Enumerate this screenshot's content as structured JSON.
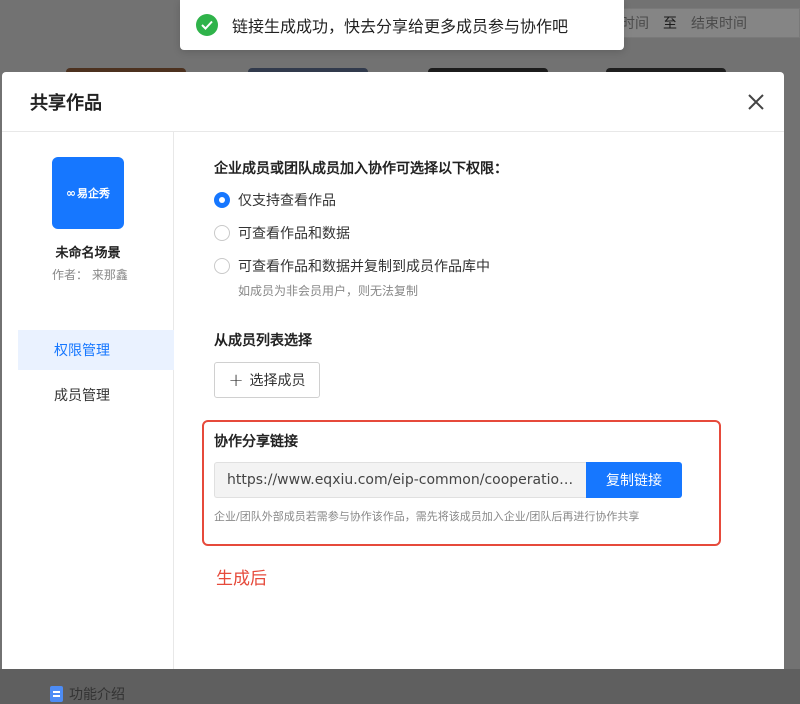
{
  "background": {
    "date_start_placeholder": "时间",
    "date_separator": "至",
    "date_end_placeholder": "结束时间"
  },
  "toast": {
    "message": "链接生成成功，快去分享给更多成员参与协作吧",
    "icon": "check-circle-icon",
    "color": "#2fb34a"
  },
  "modal": {
    "title": "共享作品",
    "close_icon": "close-icon"
  },
  "work": {
    "cover_logo": "易企秀",
    "name": "未命名场景",
    "author": "作者：  来那鑫"
  },
  "sidebar": {
    "items": [
      {
        "label": "权限管理",
        "active": true
      },
      {
        "label": "成员管理",
        "active": false
      }
    ],
    "feature_intro": "功能介绍"
  },
  "permissions": {
    "title": "企业成员或团队成员加入协作可选择以下权限：",
    "options": [
      {
        "label": "仅支持查看作品",
        "checked": true
      },
      {
        "label": "可查看作品和数据",
        "checked": false
      },
      {
        "label": "可查看作品和数据并复制到成员作品库中",
        "checked": false
      }
    ],
    "option3_note": "如成员为非会员用户，则无法复制"
  },
  "member_select": {
    "title": "从成员列表选择",
    "button_label": "选择成员"
  },
  "share_link": {
    "title": "协作分享链接",
    "url": "https://www.eqxiu.com/eip-common/cooperation...",
    "copy_button": "复制链接",
    "note": "企业/团队外部成员若需参与协作该作品，需先将该成员加入企业/团队后再进行协作共享"
  },
  "annotation": "生成后",
  "colors": {
    "accent": "#1677ff",
    "annotation_red": "#e64a3b",
    "success_green": "#2fb34a"
  }
}
